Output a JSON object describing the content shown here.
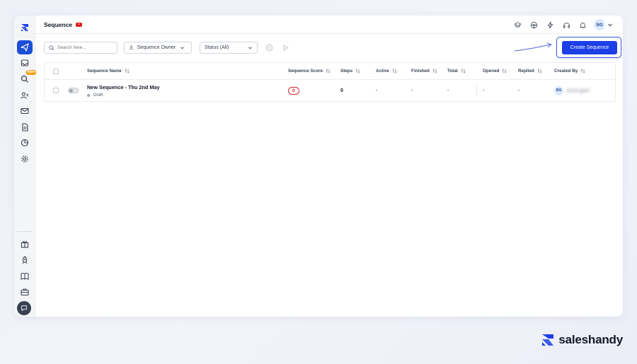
{
  "header": {
    "title": "Sequence",
    "avatar_initials": "SG"
  },
  "sidebar": {
    "items": [
      {
        "name": "sequences",
        "icon": "send-icon",
        "active": true
      },
      {
        "name": "inbox",
        "icon": "inbox-icon"
      },
      {
        "name": "lead-finder",
        "icon": "search-icon",
        "badge": "New"
      },
      {
        "name": "prospects",
        "icon": "users-icon"
      },
      {
        "name": "email-accounts",
        "icon": "mail-icon"
      },
      {
        "name": "templates",
        "icon": "document-icon"
      },
      {
        "name": "reports",
        "icon": "pie-chart-icon"
      },
      {
        "name": "settings",
        "icon": "gear-icon"
      }
    ],
    "bottom_items": [
      {
        "name": "gift",
        "icon": "gift-icon"
      },
      {
        "name": "growth",
        "icon": "rocket-icon"
      },
      {
        "name": "guides",
        "icon": "book-icon"
      },
      {
        "name": "agency",
        "icon": "briefcase-icon"
      },
      {
        "name": "chat",
        "icon": "chat-icon"
      }
    ]
  },
  "toolbar": {
    "search_placeholder": "Search here...",
    "owner_filter": "Sequence Owner",
    "status_filter": "Status (All)",
    "create_label": "Create Sequence"
  },
  "table": {
    "columns": [
      "Sequence Name",
      "Sequence Score",
      "Steps",
      "Active",
      "Finished",
      "Total",
      "Opened",
      "Replied",
      "Created By"
    ],
    "rows": [
      {
        "name": "New Sequence - Thu 2nd May",
        "status": "Draft",
        "score": "0",
        "steps": "0",
        "active": "-",
        "finished": "-",
        "total": "-",
        "opened": "-",
        "replied": "-",
        "created_by_initials": "SG",
        "created_by_name": "Sonia gaint"
      }
    ]
  },
  "brand": {
    "name": "saleshandy",
    "accent": "#1d3fe8"
  }
}
